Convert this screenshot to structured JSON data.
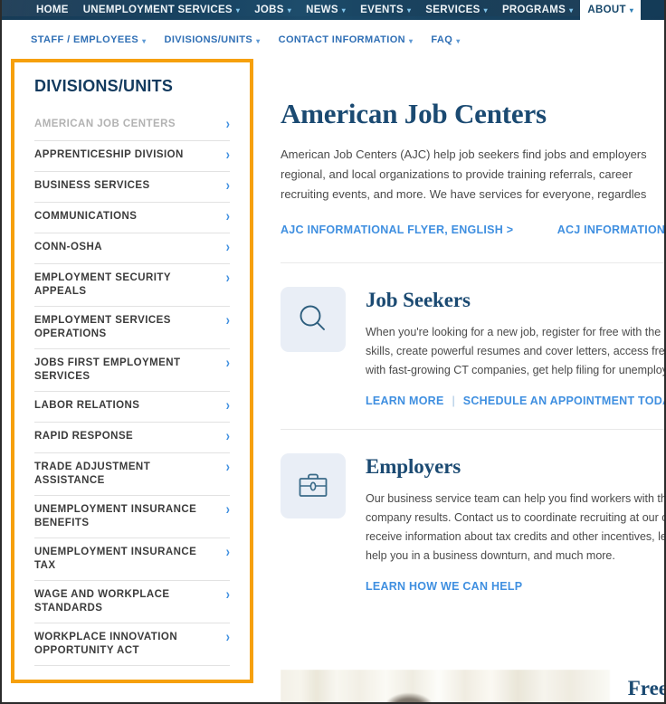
{
  "primary_nav": {
    "items": [
      {
        "label": "HOME",
        "has_caret": false,
        "active": false
      },
      {
        "label": "UNEMPLOYMENT SERVICES",
        "has_caret": true,
        "active": false
      },
      {
        "label": "JOBS",
        "has_caret": true,
        "active": false
      },
      {
        "label": "NEWS",
        "has_caret": true,
        "active": false
      },
      {
        "label": "EVENTS",
        "has_caret": true,
        "active": false
      },
      {
        "label": "SERVICES",
        "has_caret": true,
        "active": false
      },
      {
        "label": "PROGRAMS",
        "has_caret": true,
        "active": false
      },
      {
        "label": "ABOUT",
        "has_caret": true,
        "active": true
      }
    ]
  },
  "secondary_nav": {
    "items": [
      {
        "label": "STAFF / EMPLOYEES"
      },
      {
        "label": "DIVISIONS/UNITS"
      },
      {
        "label": "CONTACT INFORMATION"
      },
      {
        "label": "FAQ"
      }
    ]
  },
  "sidebar": {
    "title": "DIVISIONS/UNITS",
    "border_color": "#f6a00c",
    "items": [
      {
        "label": "AMERICAN JOB CENTERS",
        "current": true
      },
      {
        "label": "APPRENTICESHIP DIVISION",
        "current": false
      },
      {
        "label": "BUSINESS SERVICES",
        "current": false
      },
      {
        "label": "COMMUNICATIONS",
        "current": false
      },
      {
        "label": "CONN-OSHA",
        "current": false
      },
      {
        "label": "EMPLOYMENT SECURITY APPEALS",
        "current": false
      },
      {
        "label": "EMPLOYMENT SERVICES OPERATIONS",
        "current": false
      },
      {
        "label": "JOBS FIRST EMPLOYMENT SERVICES",
        "current": false
      },
      {
        "label": "LABOR RELATIONS",
        "current": false
      },
      {
        "label": "RAPID RESPONSE",
        "current": false
      },
      {
        "label": "TRADE ADJUSTMENT ASSISTANCE",
        "current": false
      },
      {
        "label": "UNEMPLOYMENT INSURANCE BENEFITS",
        "current": false
      },
      {
        "label": "UNEMPLOYMENT INSURANCE TAX",
        "current": false
      },
      {
        "label": "WAGE AND WORKPLACE STANDARDS",
        "current": false
      },
      {
        "label": "WORKPLACE INNOVATION OPPORTUNITY ACT",
        "current": false
      }
    ],
    "chevron_glyph": "›"
  },
  "main": {
    "title": "American Job Centers",
    "intro_lines": [
      "American Job Centers (AJC) help job seekers find jobs and employers",
      "regional, and local organizations to provide training referrals, career",
      "recruiting events, and more. We have services for everyone, regardles"
    ],
    "flyer_links": [
      {
        "label": "AJC INFORMATIONAL FLYER, ENGLISH >"
      },
      {
        "label": "ACJ INFORMATIONAL FLYE"
      }
    ],
    "panels": [
      {
        "icon": "search-icon",
        "title": "Job Seekers",
        "text_lines": [
          "When you're looking for a new job, register for free with the C",
          "skills, create powerful resumes and cover letters, access fres",
          "with fast-growing CT companies, get help filing for unemploy"
        ],
        "links": [
          {
            "label": "LEARN MORE"
          },
          {
            "label": "SCHEDULE AN APPOINTMENT TODAY"
          }
        ],
        "separator": "|"
      },
      {
        "icon": "briefcase-icon",
        "title": "Employers",
        "text_lines": [
          "Our business service team can help you find workers with th",
          "company results. Contact us to coordinate recruiting at our c",
          "receive information about tax credits and other incentives, le",
          "help you in a business downturn, and much more."
        ],
        "links": [
          {
            "label": "LEARN HOW WE CAN HELP"
          }
        ],
        "separator": ""
      }
    ]
  },
  "hero": {
    "heading": "Free"
  },
  "colors": {
    "nav_dark_blue": "#15354f",
    "link_blue": "#3f8fe0",
    "heading_blue": "#1b4a72",
    "accent_orange": "#f6a00c",
    "icon_tile_bg": "#e9eef6"
  }
}
